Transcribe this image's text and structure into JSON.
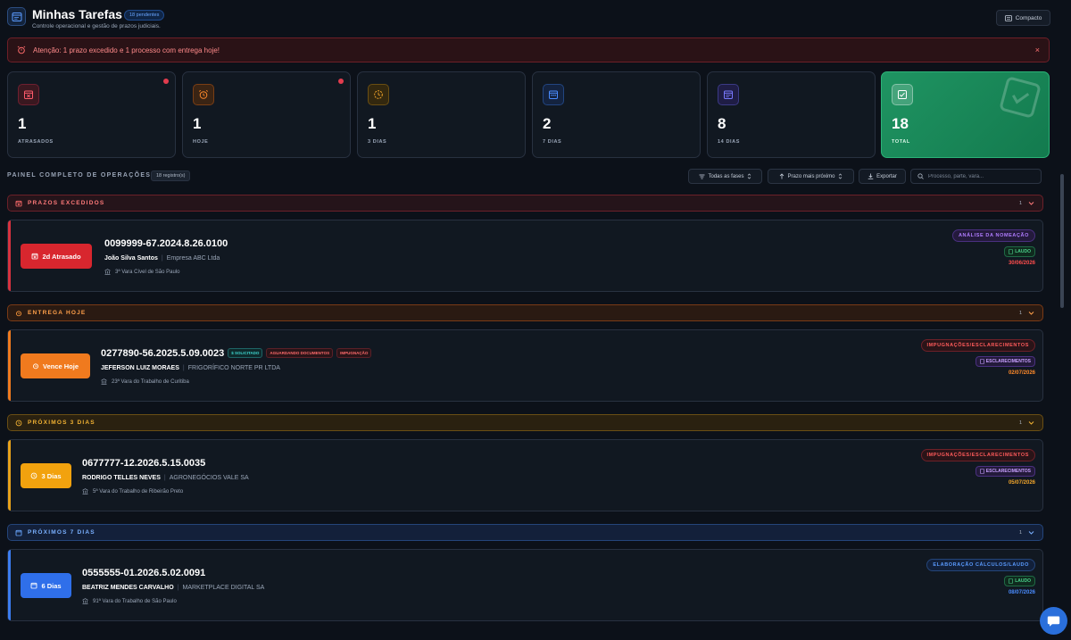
{
  "header": {
    "title": "Minhas Tarefas",
    "pending_badge": "18 pendentes",
    "subtitle": "Controle operacional e gestão de prazos judiciais.",
    "compact_label": "Compacto"
  },
  "alert": {
    "text": "Atenção: 1 prazo excedido e 1 processo com entrega hoje!",
    "close": "×"
  },
  "stats": [
    {
      "value": "1",
      "label": "ATRASADOS",
      "color": "#e23c4e"
    },
    {
      "value": "1",
      "label": "HOJE",
      "color": "#f07a1e"
    },
    {
      "value": "1",
      "label": "3 DIAS",
      "color": "#e8a21a"
    },
    {
      "value": "2",
      "label": "7 DIAS",
      "color": "#3b7cf0"
    },
    {
      "value": "8",
      "label": "14 DIAS",
      "color": "#6c6cf0"
    },
    {
      "value": "18",
      "label": "TOTAL",
      "color": "#1f9462"
    }
  ],
  "panel": {
    "title": "PAINEL COMPLETO DE OPERAÇÕES",
    "count": "18 registro(s)",
    "filter_phase": "Todas as fases",
    "sort": "Prazo mais próximo",
    "export": "Exportar",
    "search_placeholder": "Processo, parte, vara..."
  },
  "sections": [
    {
      "title": "PRAZOS EXCEDIDOS",
      "count": "1",
      "color": "#ff6b6b",
      "card": {
        "status": "2d Atrasado",
        "process": "0099999-67.2024.8.26.0100",
        "name": "João Silva Santos",
        "company": "Empresa ABC Ltda",
        "court": "3ª Vara Cível de São Paulo",
        "phase": "ANÁLISE DA NOMEAÇÃO",
        "type": "LAUDO",
        "date": "30/06/2026"
      }
    },
    {
      "title": "ENTREGA HOJE",
      "count": "1",
      "color": "#ff9a3c",
      "card": {
        "status": "Vence Hoje",
        "process": "0277890-56.2025.5.09.0023",
        "tags": [
          "$ SOLICITADO",
          "AGUARDANDO DOCUMENTOS",
          "IMPUGNAÇÃO"
        ],
        "name": "JEFERSON LUIZ MORAES",
        "company": "FRIGORÍFICO NORTE PR LTDA",
        "court": "23ª Vara do Trabalho de Curitiba",
        "phase": "IMPUGNAÇÕES/ESCLARECIMENTOS",
        "type": "ESCLARECIMENTOS",
        "date": "02/07/2026"
      }
    },
    {
      "title": "PRÓXIMOS 3 DIAS",
      "count": "1",
      "color": "#f2b233",
      "card": {
        "status": "3 Dias",
        "process": "0677777-12.2026.5.15.0035",
        "name": "RODRIGO TELLES NEVES",
        "company": "AGRONEGÓCIOS VALE SA",
        "court": "5ª Vara do Trabalho de Ribeirão Preto",
        "phase": "IMPUGNAÇÕES/ESCLARECIMENTOS",
        "type": "ESCLARECIMENTOS",
        "date": "05/07/2026"
      }
    },
    {
      "title": "PRÓXIMOS 7 DIAS",
      "count": "1",
      "color": "#6aa6ff",
      "card": {
        "status": "6 Dias",
        "process": "0555555-01.2026.5.02.0091",
        "name": "BEATRIZ MENDES CARVALHO",
        "company": "MARKETPLACE DIGITAL SA",
        "court": "91ª Vara do Trabalho de São Paulo",
        "phase": "ELABORAÇÃO CÁLCULOS/LAUDO",
        "type": "LAUDO",
        "date": "08/07/2026"
      }
    }
  ]
}
